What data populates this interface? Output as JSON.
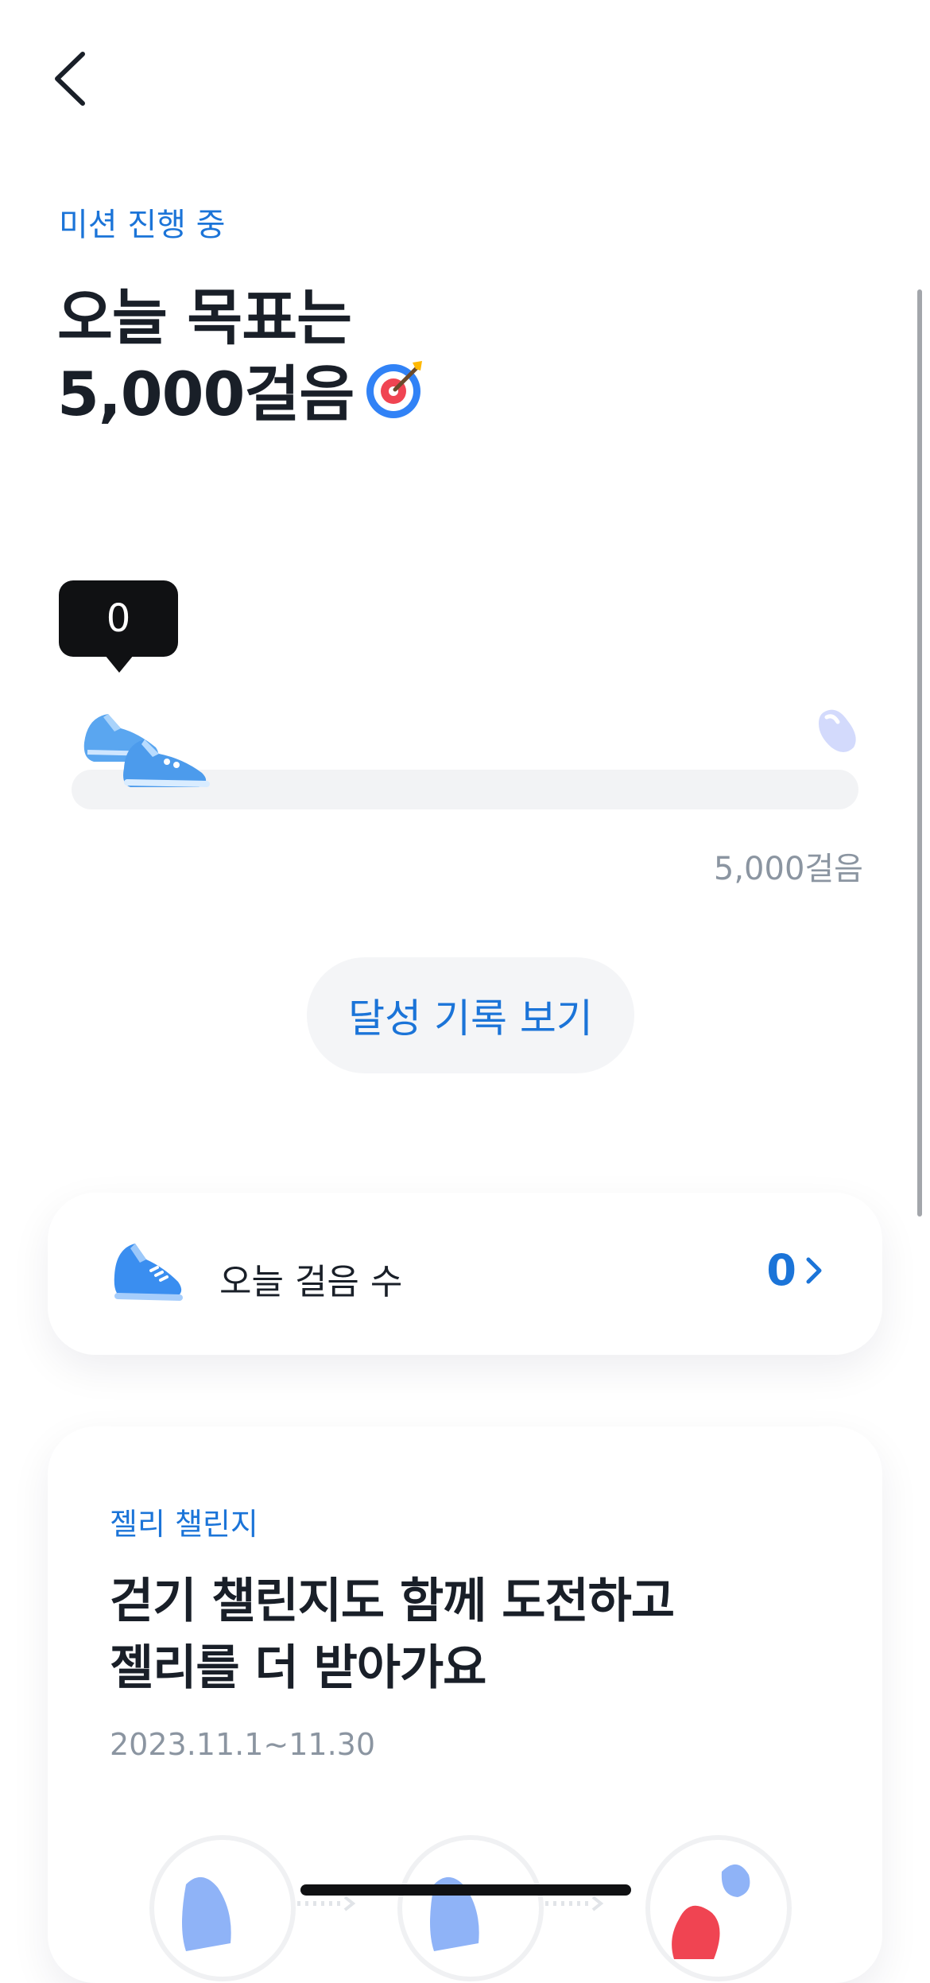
{
  "header": {
    "back_icon": "chevron-left-icon"
  },
  "mission": {
    "status": "미션 진행 중",
    "title_line1": "오늘 목표는",
    "title_line2": "5,000걸음",
    "title_icon": "target-icon"
  },
  "progress": {
    "current_steps": "0",
    "goal_label": "5,000걸음",
    "fraction": 0,
    "start_icon": "sneakers-icon",
    "end_icon": "jelly-icon"
  },
  "history_button": {
    "label": "달성 기록 보기"
  },
  "steps_card": {
    "icon": "sneaker-icon",
    "label": "오늘 걸음 수",
    "value": "0",
    "chevron": "chevron-right-icon"
  },
  "challenge": {
    "tag": "젤리 챌린지",
    "title_line1": "걷기 챌린지도 함께 도전하고",
    "title_line2": "젤리를 더 받아가요",
    "date": "2023.11.1~11.30"
  },
  "colors": {
    "accent": "#1b74d8",
    "track": "#f2f3f5",
    "tooltip_bg": "#101113",
    "muted_text": "#8b95a1"
  }
}
